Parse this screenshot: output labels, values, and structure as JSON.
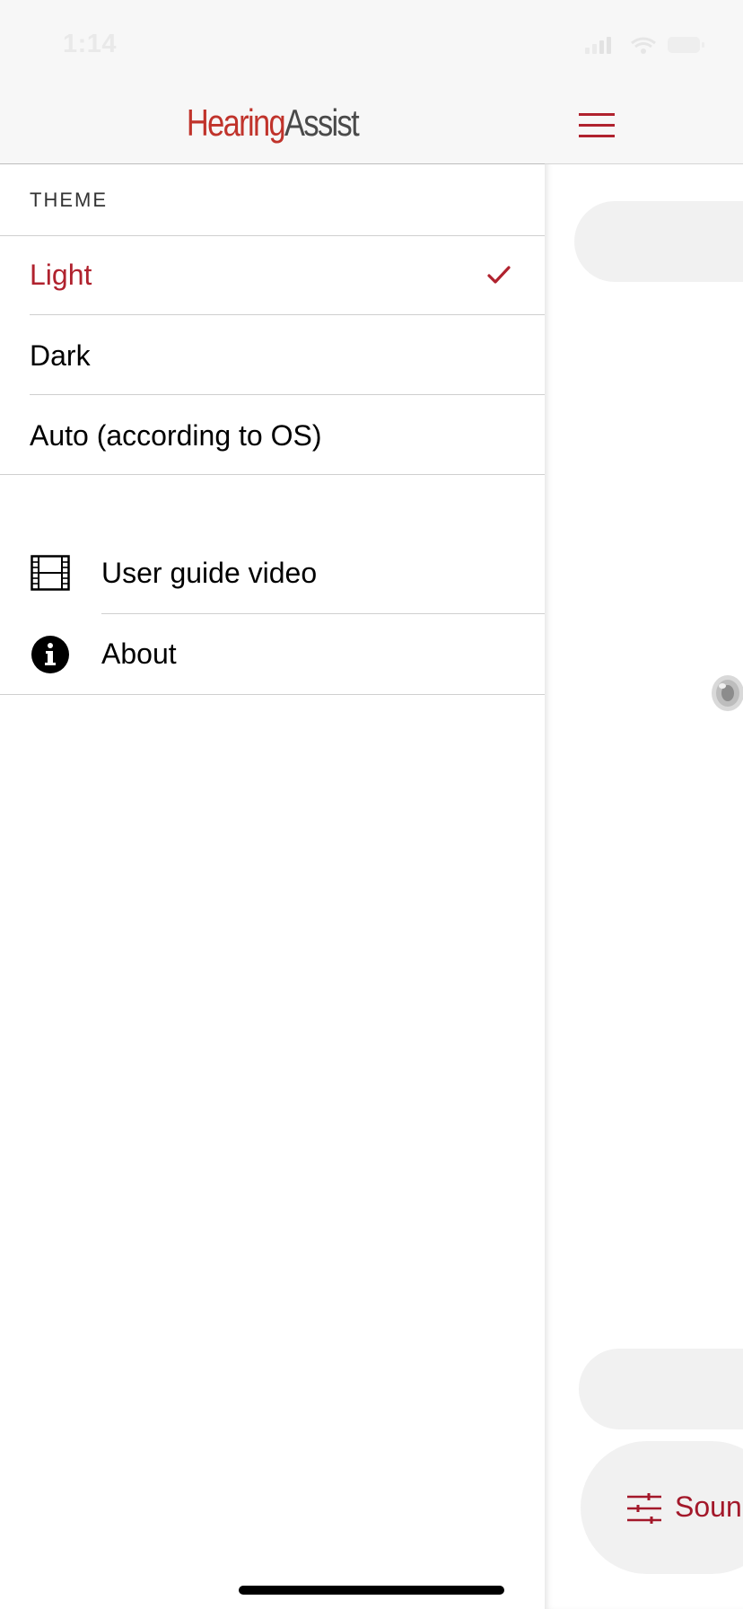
{
  "status_bar": {
    "time": "1:14"
  },
  "app": {
    "logo_part1": "Hearing",
    "logo_part2": "Assist"
  },
  "drawer": {
    "theme_header": "THEME",
    "themes": [
      {
        "label": "Light",
        "selected": true
      },
      {
        "label": "Dark",
        "selected": false
      },
      {
        "label": "Auto (according to OS)",
        "selected": false
      }
    ],
    "menu": [
      {
        "label": "User guide video",
        "icon": "film-icon"
      },
      {
        "label": "About",
        "icon": "info-icon"
      }
    ]
  },
  "main": {
    "sound_button_label": "Soun"
  },
  "colors": {
    "accent": "#b0222e",
    "logo_red": "#c0332b",
    "header_bg": "#f7f7f7",
    "pill_bg": "#f1f1f1"
  }
}
